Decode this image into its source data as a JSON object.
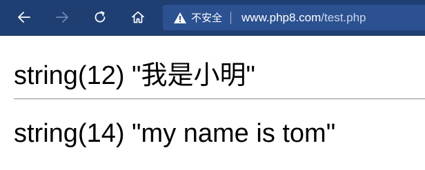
{
  "browser": {
    "security_label": "不安全",
    "url_host": "www.php8.com",
    "url_path": "/test.php",
    "icons": {
      "back": "back-arrow-icon",
      "forward": "forward-arrow-icon",
      "refresh": "refresh-icon",
      "home": "home-icon",
      "warning": "warning-triangle-icon"
    }
  },
  "page": {
    "lines": [
      "string(12) \"我是小明\"",
      "string(14) \"my name is tom\""
    ]
  },
  "colors": {
    "toolbar": "#1f3f73",
    "address_bar": "#2c5191",
    "text": "#000000"
  }
}
